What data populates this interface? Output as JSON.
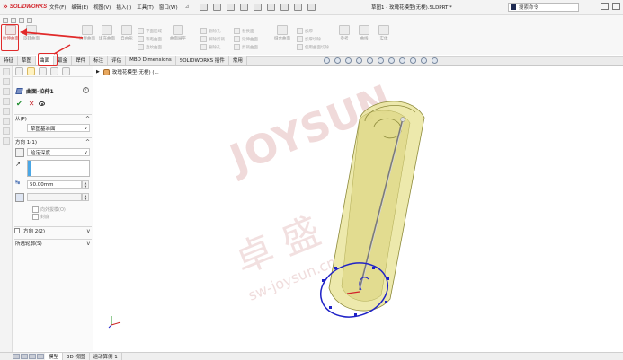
{
  "titlebar": {
    "logo_text": "SOLIDWORKS",
    "menu": [
      "文件(F)",
      "编辑(E)",
      "视图(V)",
      "插入(I)",
      "工具(T)",
      "窗口(W)"
    ],
    "document_title": "草图1 - 玫瑰花模型(无梗).SLDPRT *",
    "search_placeholder": "搜索命令"
  },
  "toolbar": {
    "tools": [
      {
        "label": "拉伸曲面",
        "active": true
      },
      {
        "label": "旋转曲面"
      },
      {
        "label": "扫描曲面"
      },
      {
        "label": "放样曲面"
      },
      {
        "label": "边界曲面"
      },
      {
        "label": "填充曲面"
      },
      {
        "label": "自由形"
      },
      {
        "label": "曲面展平"
      },
      {
        "label": "缝合曲面"
      },
      {
        "label": "删除面"
      },
      {
        "label": "替换面"
      },
      {
        "label": "延伸曲面"
      },
      {
        "label": "剪裁曲面"
      },
      {
        "label": "加厚"
      },
      {
        "label": "参考"
      },
      {
        "label": "曲线"
      },
      {
        "label": "实体"
      }
    ],
    "stack1": [
      "平面区域",
      "等距曲面",
      "直纹曲面"
    ],
    "stack2": [
      "删除孔",
      "解除剪裁",
      "删除孔"
    ],
    "stack3": [
      "加厚",
      "加厚切除",
      "使用曲面切除"
    ]
  },
  "tabs": [
    "特征",
    "草图",
    "曲面",
    "钣金",
    "焊件",
    "标注",
    "评估",
    "MBD Dimensions",
    "SOLIDWORKS 插件",
    "常用"
  ],
  "panel": {
    "feature_title": "曲面-拉伸1",
    "help": "?",
    "ok": "✔",
    "cancel": "✕",
    "from_label": "从(F)",
    "from_value": "草图基准面",
    "direction1_label": "方向 1(1)",
    "end_condition": "给定深度",
    "depth": "50.00mm",
    "opt_outward": "向外拔模(O)",
    "opt_cap": "封底",
    "direction2_label": "方向 2(2)",
    "contours_label": "所选轮廓(S)",
    "chevron_up": "^",
    "chevron_down": "v"
  },
  "viewport": {
    "tree_label": "玫瑰花模型(无梗) (...",
    "watermark_large": "JOYSUN",
    "watermark_cn": "卓 盛",
    "watermark_url": "sw-joysun.cn"
  },
  "bottom_tabs": [
    "模型",
    "3D 视图",
    "运动算例 1"
  ],
  "colors": {
    "accent_red": "#d2232a",
    "annotation_red": "#e12a2a",
    "surface_fill": "#e8e39a",
    "surface_edge": "#8d8a3b",
    "sketch_blue": "#1f22c7"
  }
}
